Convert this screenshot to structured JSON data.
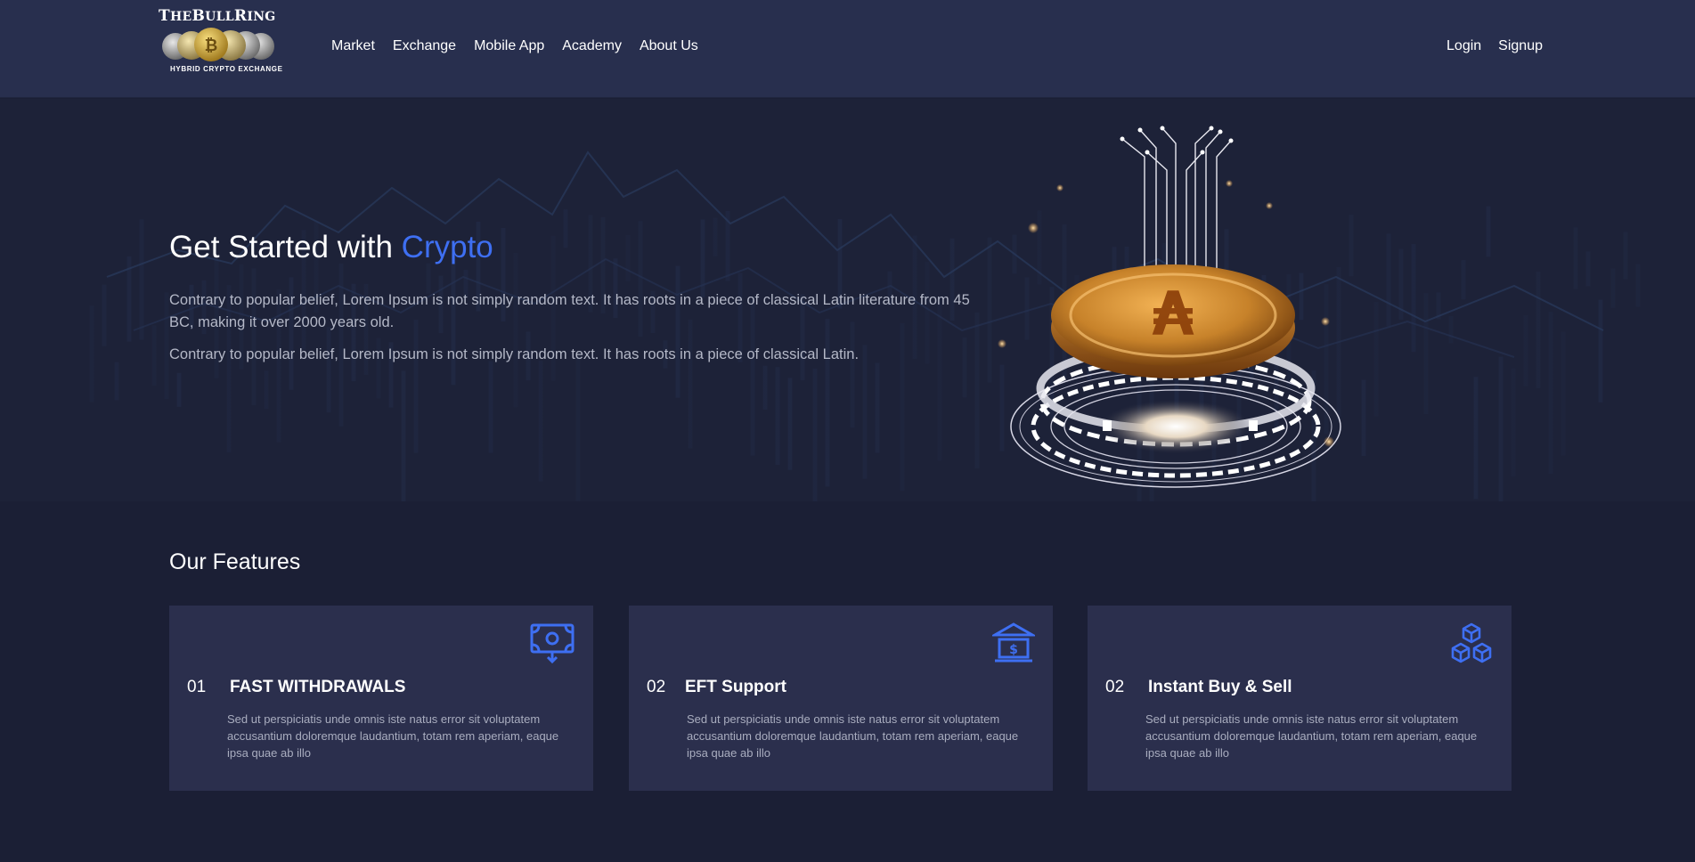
{
  "brand": {
    "logo_main_big_1": "T",
    "logo_main_small_1": "HE",
    "logo_main_big_2": "B",
    "logo_main_small_2": "ULL",
    "logo_main_big_3": "R",
    "logo_main_small_3": "ING",
    "tagline": "HYBRID CRYPTO EXCHANGE"
  },
  "nav": {
    "items": [
      "Market",
      "Exchange",
      "Mobile App",
      "Academy",
      "About Us"
    ],
    "login": "Login",
    "signup": "Signup"
  },
  "hero": {
    "title_prefix": "Get Started with ",
    "title_accent": "Crypto",
    "paragraph_1": "Contrary to popular belief, Lorem Ipsum is not simply random text. It has roots in a piece of classical Latin literature from 45 BC, making it over 2000 years old.",
    "paragraph_2": "Contrary to popular belief, Lorem Ipsum is not simply random text. It has roots in a piece of classical Latin."
  },
  "features": {
    "title": "Our Features",
    "cards": [
      {
        "number": "01",
        "title": "FAST WITHDRAWALS",
        "icon": "money-withdraw-icon",
        "description": "Sed ut perspiciatis unde omnis iste natus error sit voluptatem accusantium doloremque laudantium, totam rem aperiam, eaque ipsa quae ab illo"
      },
      {
        "number": "02",
        "title": "EFT Support",
        "icon": "bank-icon",
        "description": "Sed ut perspiciatis unde omnis iste natus error sit voluptatem accusantium doloremque laudantium, totam rem aperiam, eaque ipsa quae ab illo"
      },
      {
        "number": "02",
        "title": "Instant Buy & Sell",
        "icon": "blocks-icon",
        "description": "Sed ut perspiciatis unde omnis iste natus error sit voluptatem accusantium doloremque laudantium, totam rem aperiam, eaque ipsa quae ab illo"
      }
    ]
  },
  "colors": {
    "header_bg": "#282f4e",
    "page_bg": "#1b1f35",
    "accent": "#3e6ff2",
    "card_bg": "#2b2f4d",
    "coin_gold": "#c98a2a"
  }
}
